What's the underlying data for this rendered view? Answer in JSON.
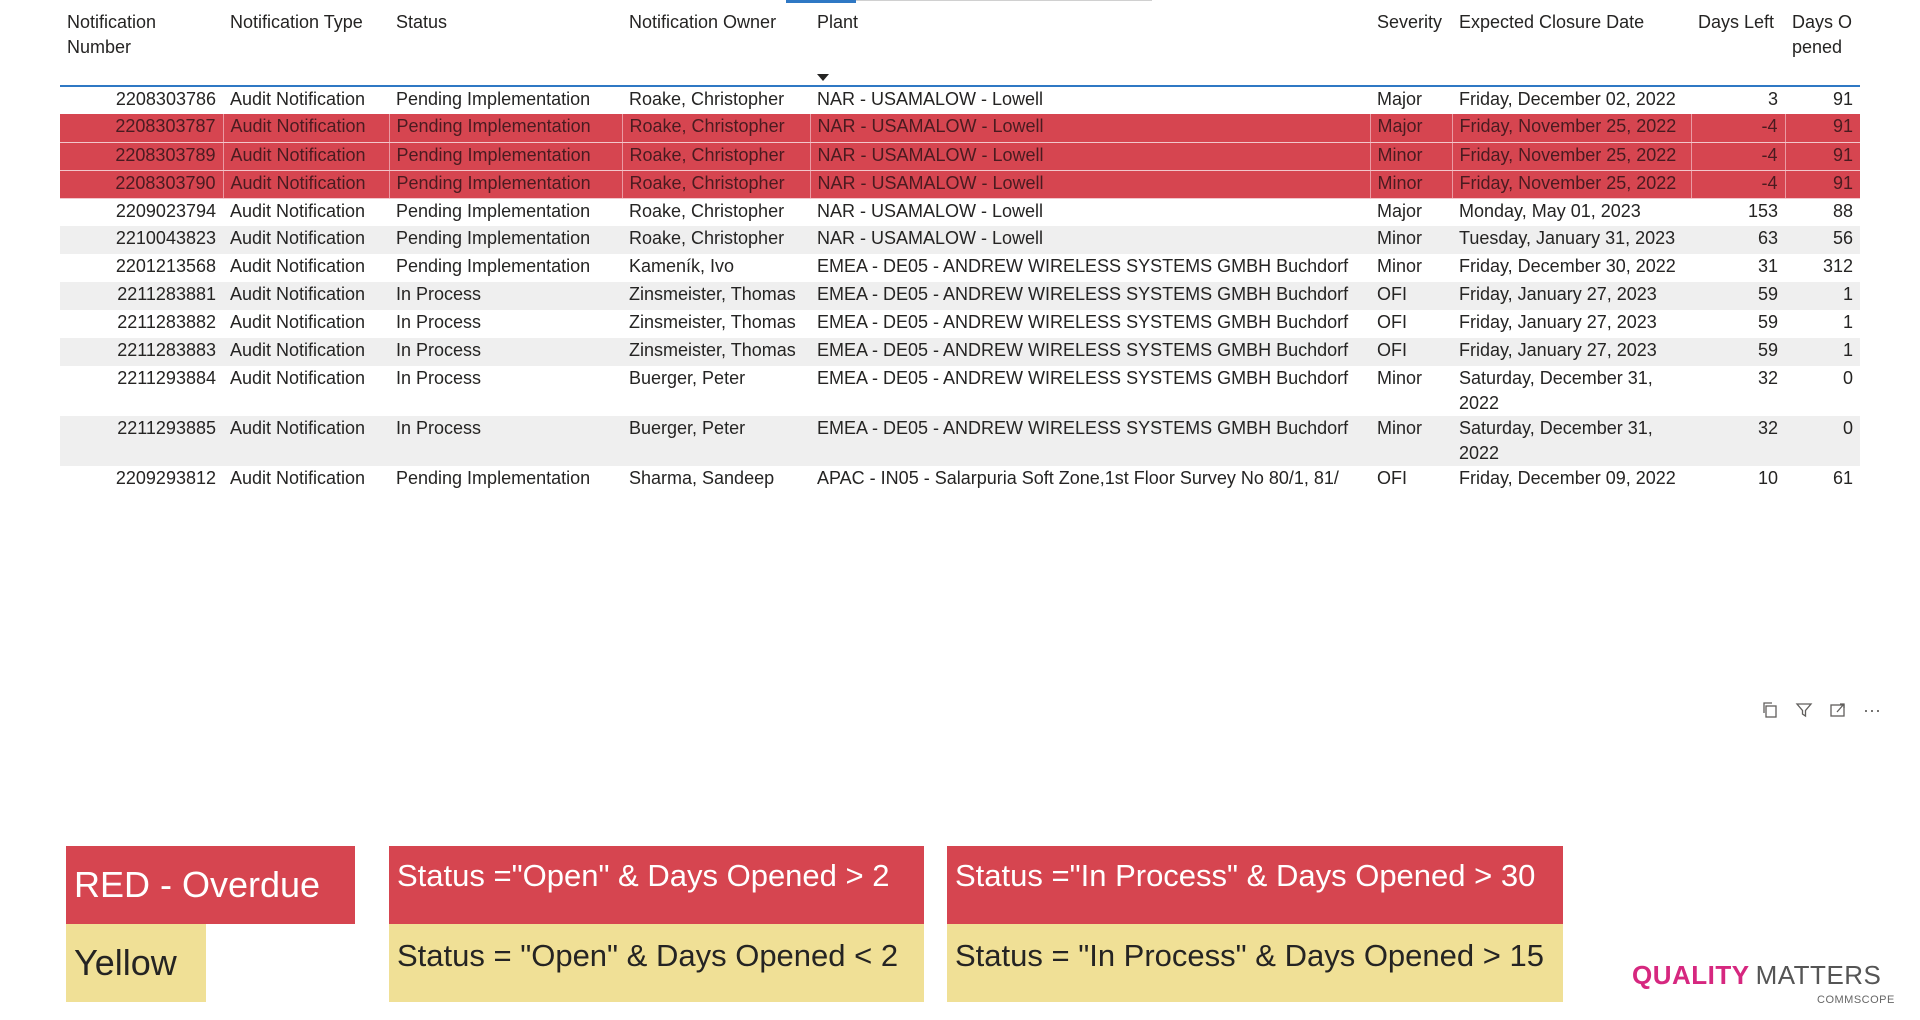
{
  "table": {
    "columns": [
      "Notification Number",
      "Notification Type",
      "Status",
      "Notification Owner",
      "Plant",
      "Severity",
      "Expected Closure Date",
      "Days Left",
      "Days Opened"
    ],
    "rows": [
      {
        "number": "2208303786",
        "type": "Audit Notification",
        "status": "Pending Implementation",
        "owner": "Roake, Christopher",
        "plant": "NAR - USAMALOW - Lowell",
        "severity": "Major",
        "date": "Friday, December 02, 2022",
        "days_left": "3",
        "days_opened": "91",
        "highlight": "none"
      },
      {
        "number": "2208303787",
        "type": "Audit Notification",
        "status": "Pending Implementation",
        "owner": "Roake, Christopher",
        "plant": "NAR - USAMALOW - Lowell",
        "severity": "Major",
        "date": "Friday, November 25, 2022",
        "days_left": "-4",
        "days_opened": "91",
        "highlight": "red"
      },
      {
        "number": "2208303789",
        "type": "Audit Notification",
        "status": "Pending Implementation",
        "owner": "Roake, Christopher",
        "plant": "NAR - USAMALOW - Lowell",
        "severity": "Minor",
        "date": "Friday, November 25, 2022",
        "days_left": "-4",
        "days_opened": "91",
        "highlight": "red"
      },
      {
        "number": "2208303790",
        "type": "Audit Notification",
        "status": "Pending Implementation",
        "owner": "Roake, Christopher",
        "plant": "NAR - USAMALOW - Lowell",
        "severity": "Minor",
        "date": "Friday, November 25, 2022",
        "days_left": "-4",
        "days_opened": "91",
        "highlight": "red"
      },
      {
        "number": "2209023794",
        "type": "Audit Notification",
        "status": "Pending Implementation",
        "owner": "Roake, Christopher",
        "plant": "NAR - USAMALOW - Lowell",
        "severity": "Major",
        "date": "Monday, May 01, 2023",
        "days_left": "153",
        "days_opened": "88",
        "highlight": "none"
      },
      {
        "number": "2210043823",
        "type": "Audit Notification",
        "status": "Pending Implementation",
        "owner": "Roake, Christopher",
        "plant": "NAR - USAMALOW - Lowell",
        "severity": "Minor",
        "date": "Tuesday, January 31, 2023",
        "days_left": "63",
        "days_opened": "56",
        "highlight": "none"
      },
      {
        "number": "2201213568",
        "type": "Audit Notification",
        "status": "Pending Implementation",
        "owner": "Kameník, Ivo",
        "plant": "EMEA - DE05 - ANDREW WIRELESS SYSTEMS GMBH Buchdorf",
        "severity": "Minor",
        "date": "Friday, December 30, 2022",
        "days_left": "31",
        "days_opened": "312",
        "highlight": "none"
      },
      {
        "number": "2211283881",
        "type": "Audit Notification",
        "status": "In Process",
        "owner": "Zinsmeister, Thomas",
        "plant": "EMEA - DE05 - ANDREW WIRELESS SYSTEMS GMBH Buchdorf",
        "severity": "OFI",
        "date": "Friday, January 27, 2023",
        "days_left": "59",
        "days_opened": "1",
        "highlight": "none"
      },
      {
        "number": "2211283882",
        "type": "Audit Notification",
        "status": "In Process",
        "owner": "Zinsmeister, Thomas",
        "plant": "EMEA - DE05 - ANDREW WIRELESS SYSTEMS GMBH Buchdorf",
        "severity": "OFI",
        "date": "Friday, January 27, 2023",
        "days_left": "59",
        "days_opened": "1",
        "highlight": "none"
      },
      {
        "number": "2211283883",
        "type": "Audit Notification",
        "status": "In Process",
        "owner": "Zinsmeister, Thomas",
        "plant": "EMEA - DE05 - ANDREW WIRELESS SYSTEMS GMBH Buchdorf",
        "severity": "OFI",
        "date": "Friday, January 27, 2023",
        "days_left": "59",
        "days_opened": "1",
        "highlight": "none"
      },
      {
        "number": "2211293884",
        "type": "Audit Notification",
        "status": "In Process",
        "owner": "Buerger, Peter",
        "plant": "EMEA - DE05 - ANDREW WIRELESS SYSTEMS GMBH Buchdorf",
        "severity": "Minor",
        "date": "Saturday, December 31, 2022",
        "days_left": "32",
        "days_opened": "0",
        "highlight": "none"
      },
      {
        "number": "2211293885",
        "type": "Audit Notification",
        "status": "In Process",
        "owner": "Buerger, Peter",
        "plant": "EMEA - DE05 - ANDREW WIRELESS SYSTEMS GMBH Buchdorf",
        "severity": "Minor",
        "date": "Saturday, December 31, 2022",
        "days_left": "32",
        "days_opened": "0",
        "highlight": "none"
      },
      {
        "number": "2209293812",
        "type": "Audit Notification",
        "status": "Pending Implementation",
        "owner": "Sharma, Sandeep",
        "plant": "APAC - IN05 - Salarpuria Soft Zone,1st Floor Survey No 80/1, 81/",
        "severity": "OFI",
        "date": "Friday, December 09, 2022",
        "days_left": "10",
        "days_opened": "61",
        "highlight": "none"
      }
    ]
  },
  "toolbar": {
    "icons": [
      "copy-icon",
      "filter-icon",
      "focus-mode-icon",
      "more-options-icon"
    ],
    "more_glyph": "···"
  },
  "legend": {
    "red_label": "RED - Overdue",
    "yellow_label": "Yellow",
    "open_red": "Status =\"Open\" & Days Opened > 2",
    "open_yellow": "Status = \"Open\" & Days Opened < 2",
    "inprocess_red": "Status =\"In Process\" & Days Opened > 30",
    "inprocess_yellow": "Status = \"In Process\" & Days Opened > 15"
  },
  "brand": {
    "quality": "QUALITY",
    "matters": "MATTERS",
    "company": "COMMSCOPE"
  },
  "colors": {
    "red": "#d64550",
    "yellow": "#f0e096",
    "accent": "#2f78c4",
    "brand_pink": "#d6277f"
  }
}
